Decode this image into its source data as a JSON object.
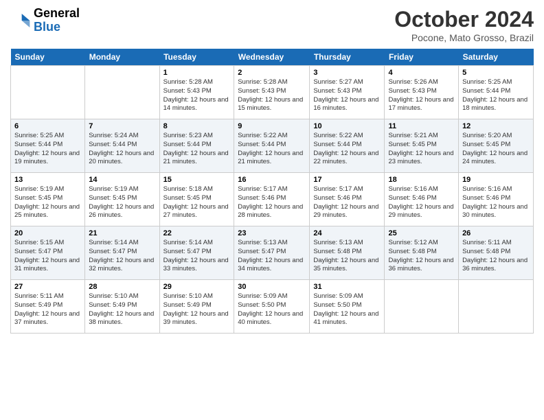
{
  "header": {
    "logo_general": "General",
    "logo_blue": "Blue",
    "month_title": "October 2024",
    "subtitle": "Pocone, Mato Grosso, Brazil"
  },
  "weekdays": [
    "Sunday",
    "Monday",
    "Tuesday",
    "Wednesday",
    "Thursday",
    "Friday",
    "Saturday"
  ],
  "weeks": [
    [
      {
        "day": "",
        "sunrise": "",
        "sunset": "",
        "daylight": ""
      },
      {
        "day": "",
        "sunrise": "",
        "sunset": "",
        "daylight": ""
      },
      {
        "day": "1",
        "sunrise": "Sunrise: 5:28 AM",
        "sunset": "Sunset: 5:43 PM",
        "daylight": "Daylight: 12 hours and 14 minutes."
      },
      {
        "day": "2",
        "sunrise": "Sunrise: 5:28 AM",
        "sunset": "Sunset: 5:43 PM",
        "daylight": "Daylight: 12 hours and 15 minutes."
      },
      {
        "day": "3",
        "sunrise": "Sunrise: 5:27 AM",
        "sunset": "Sunset: 5:43 PM",
        "daylight": "Daylight: 12 hours and 16 minutes."
      },
      {
        "day": "4",
        "sunrise": "Sunrise: 5:26 AM",
        "sunset": "Sunset: 5:43 PM",
        "daylight": "Daylight: 12 hours and 17 minutes."
      },
      {
        "day": "5",
        "sunrise": "Sunrise: 5:25 AM",
        "sunset": "Sunset: 5:44 PM",
        "daylight": "Daylight: 12 hours and 18 minutes."
      }
    ],
    [
      {
        "day": "6",
        "sunrise": "Sunrise: 5:25 AM",
        "sunset": "Sunset: 5:44 PM",
        "daylight": "Daylight: 12 hours and 19 minutes."
      },
      {
        "day": "7",
        "sunrise": "Sunrise: 5:24 AM",
        "sunset": "Sunset: 5:44 PM",
        "daylight": "Daylight: 12 hours and 20 minutes."
      },
      {
        "day": "8",
        "sunrise": "Sunrise: 5:23 AM",
        "sunset": "Sunset: 5:44 PM",
        "daylight": "Daylight: 12 hours and 21 minutes."
      },
      {
        "day": "9",
        "sunrise": "Sunrise: 5:22 AM",
        "sunset": "Sunset: 5:44 PM",
        "daylight": "Daylight: 12 hours and 21 minutes."
      },
      {
        "day": "10",
        "sunrise": "Sunrise: 5:22 AM",
        "sunset": "Sunset: 5:44 PM",
        "daylight": "Daylight: 12 hours and 22 minutes."
      },
      {
        "day": "11",
        "sunrise": "Sunrise: 5:21 AM",
        "sunset": "Sunset: 5:45 PM",
        "daylight": "Daylight: 12 hours and 23 minutes."
      },
      {
        "day": "12",
        "sunrise": "Sunrise: 5:20 AM",
        "sunset": "Sunset: 5:45 PM",
        "daylight": "Daylight: 12 hours and 24 minutes."
      }
    ],
    [
      {
        "day": "13",
        "sunrise": "Sunrise: 5:19 AM",
        "sunset": "Sunset: 5:45 PM",
        "daylight": "Daylight: 12 hours and 25 minutes."
      },
      {
        "day": "14",
        "sunrise": "Sunrise: 5:19 AM",
        "sunset": "Sunset: 5:45 PM",
        "daylight": "Daylight: 12 hours and 26 minutes."
      },
      {
        "day": "15",
        "sunrise": "Sunrise: 5:18 AM",
        "sunset": "Sunset: 5:45 PM",
        "daylight": "Daylight: 12 hours and 27 minutes."
      },
      {
        "day": "16",
        "sunrise": "Sunrise: 5:17 AM",
        "sunset": "Sunset: 5:46 PM",
        "daylight": "Daylight: 12 hours and 28 minutes."
      },
      {
        "day": "17",
        "sunrise": "Sunrise: 5:17 AM",
        "sunset": "Sunset: 5:46 PM",
        "daylight": "Daylight: 12 hours and 29 minutes."
      },
      {
        "day": "18",
        "sunrise": "Sunrise: 5:16 AM",
        "sunset": "Sunset: 5:46 PM",
        "daylight": "Daylight: 12 hours and 29 minutes."
      },
      {
        "day": "19",
        "sunrise": "Sunrise: 5:16 AM",
        "sunset": "Sunset: 5:46 PM",
        "daylight": "Daylight: 12 hours and 30 minutes."
      }
    ],
    [
      {
        "day": "20",
        "sunrise": "Sunrise: 5:15 AM",
        "sunset": "Sunset: 5:47 PM",
        "daylight": "Daylight: 12 hours and 31 minutes."
      },
      {
        "day": "21",
        "sunrise": "Sunrise: 5:14 AM",
        "sunset": "Sunset: 5:47 PM",
        "daylight": "Daylight: 12 hours and 32 minutes."
      },
      {
        "day": "22",
        "sunrise": "Sunrise: 5:14 AM",
        "sunset": "Sunset: 5:47 PM",
        "daylight": "Daylight: 12 hours and 33 minutes."
      },
      {
        "day": "23",
        "sunrise": "Sunrise: 5:13 AM",
        "sunset": "Sunset: 5:47 PM",
        "daylight": "Daylight: 12 hours and 34 minutes."
      },
      {
        "day": "24",
        "sunrise": "Sunrise: 5:13 AM",
        "sunset": "Sunset: 5:48 PM",
        "daylight": "Daylight: 12 hours and 35 minutes."
      },
      {
        "day": "25",
        "sunrise": "Sunrise: 5:12 AM",
        "sunset": "Sunset: 5:48 PM",
        "daylight": "Daylight: 12 hours and 36 minutes."
      },
      {
        "day": "26",
        "sunrise": "Sunrise: 5:11 AM",
        "sunset": "Sunset: 5:48 PM",
        "daylight": "Daylight: 12 hours and 36 minutes."
      }
    ],
    [
      {
        "day": "27",
        "sunrise": "Sunrise: 5:11 AM",
        "sunset": "Sunset: 5:49 PM",
        "daylight": "Daylight: 12 hours and 37 minutes."
      },
      {
        "day": "28",
        "sunrise": "Sunrise: 5:10 AM",
        "sunset": "Sunset: 5:49 PM",
        "daylight": "Daylight: 12 hours and 38 minutes."
      },
      {
        "day": "29",
        "sunrise": "Sunrise: 5:10 AM",
        "sunset": "Sunset: 5:49 PM",
        "daylight": "Daylight: 12 hours and 39 minutes."
      },
      {
        "day": "30",
        "sunrise": "Sunrise: 5:09 AM",
        "sunset": "Sunset: 5:50 PM",
        "daylight": "Daylight: 12 hours and 40 minutes."
      },
      {
        "day": "31",
        "sunrise": "Sunrise: 5:09 AM",
        "sunset": "Sunset: 5:50 PM",
        "daylight": "Daylight: 12 hours and 41 minutes."
      },
      {
        "day": "",
        "sunrise": "",
        "sunset": "",
        "daylight": ""
      },
      {
        "day": "",
        "sunrise": "",
        "sunset": "",
        "daylight": ""
      }
    ]
  ]
}
